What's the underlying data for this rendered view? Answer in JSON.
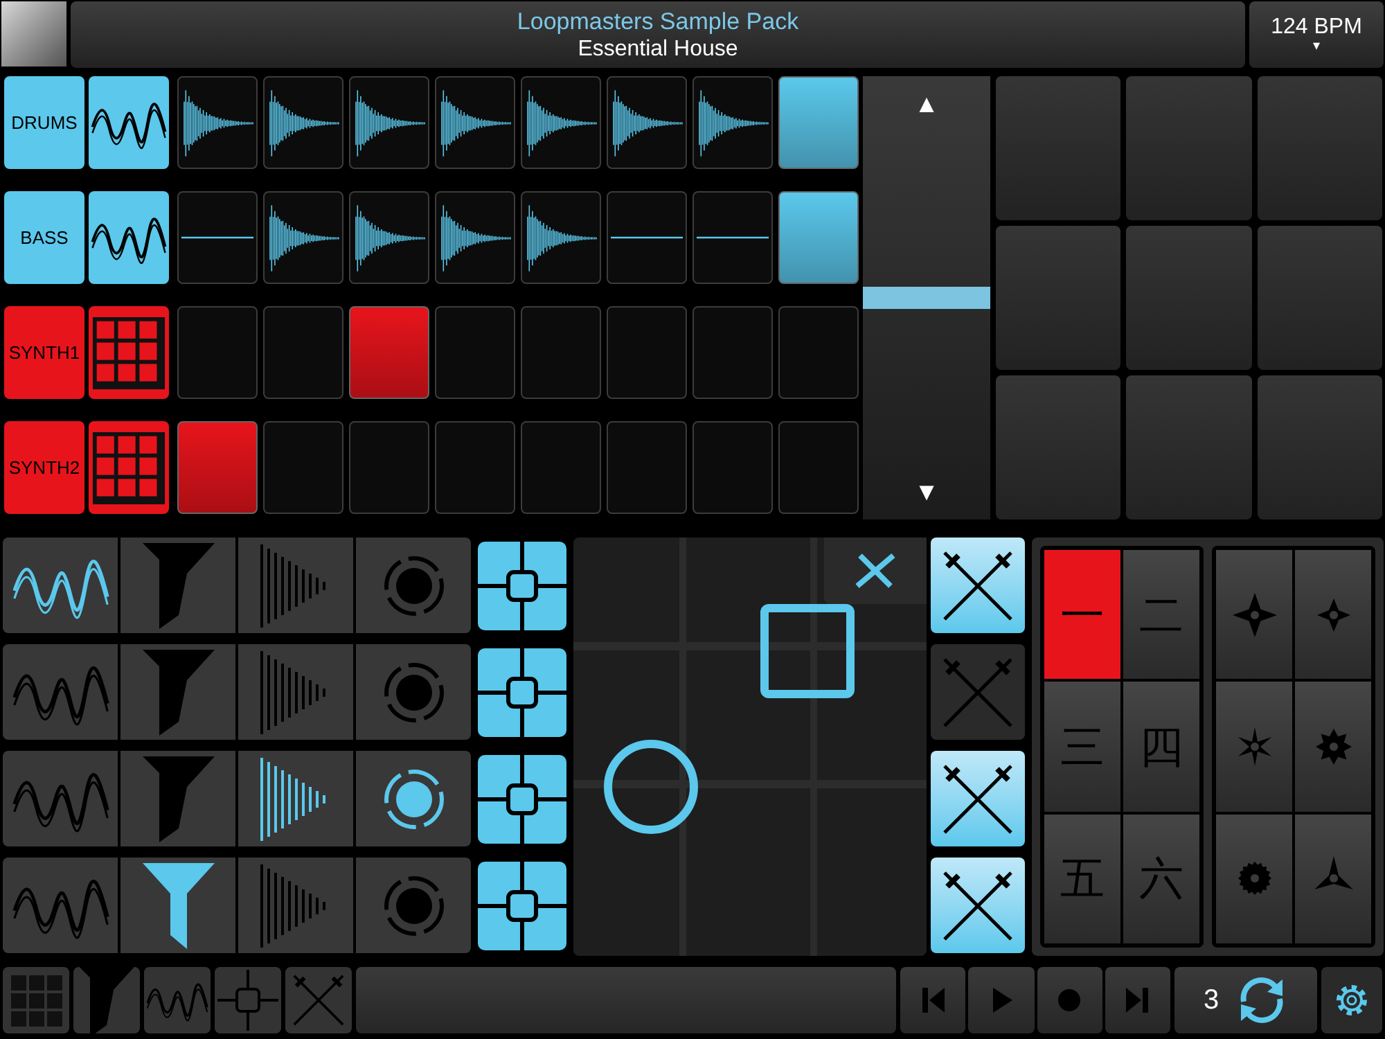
{
  "header": {
    "title": "Loopmasters Sample Pack",
    "subtitle": "Essential House",
    "tempo": "124 BPM",
    "tempo_caret": "▾"
  },
  "tracks": [
    {
      "name": "DRUMS",
      "kind": "audio",
      "color": "#5bc8ec",
      "clips": [
        {
          "kind": "hit",
          "lit": false
        },
        {
          "kind": "hit",
          "lit": false
        },
        {
          "kind": "hit",
          "lit": false
        },
        {
          "kind": "hit",
          "lit": false
        },
        {
          "kind": "hit",
          "lit": false
        },
        {
          "kind": "hit",
          "lit": false
        },
        {
          "kind": "hit",
          "lit": false
        },
        {
          "kind": "empty",
          "lit": true
        }
      ]
    },
    {
      "name": "BASS",
      "kind": "audio",
      "color": "#5bc8ec",
      "clips": [
        {
          "kind": "flat",
          "lit": false
        },
        {
          "kind": "hit",
          "lit": false
        },
        {
          "kind": "hit",
          "lit": false
        },
        {
          "kind": "hit",
          "lit": false
        },
        {
          "kind": "hit",
          "lit": false
        },
        {
          "kind": "flat",
          "lit": false
        },
        {
          "kind": "flat",
          "lit": false
        },
        {
          "kind": "empty",
          "lit": true
        }
      ]
    },
    {
      "name": "SYNTH1",
      "kind": "midi",
      "color": "#e8141c",
      "clips": [
        {
          "kind": "empty",
          "lit": false
        },
        {
          "kind": "empty",
          "lit": false
        },
        {
          "kind": "empty",
          "lit": true
        },
        {
          "kind": "empty",
          "lit": false
        },
        {
          "kind": "empty",
          "lit": false
        },
        {
          "kind": "empty",
          "lit": false
        },
        {
          "kind": "empty",
          "lit": false
        },
        {
          "kind": "empty",
          "lit": false
        }
      ]
    },
    {
      "name": "SYNTH2",
      "kind": "midi",
      "color": "#e8141c",
      "clips": [
        {
          "kind": "empty",
          "lit": true
        },
        {
          "kind": "empty",
          "lit": false
        },
        {
          "kind": "empty",
          "lit": false
        },
        {
          "kind": "empty",
          "lit": false
        },
        {
          "kind": "empty",
          "lit": false
        },
        {
          "kind": "empty",
          "lit": false
        },
        {
          "kind": "empty",
          "lit": false
        },
        {
          "kind": "empty",
          "lit": false
        }
      ]
    }
  ],
  "volume": {
    "up": "▲",
    "down": "▼",
    "level": 0.5
  },
  "effects": [
    {
      "chain": [
        {
          "kind": "oscillator",
          "on": true
        },
        {
          "kind": "filter",
          "on": false
        },
        {
          "kind": "delay",
          "on": false
        },
        {
          "kind": "reverb",
          "on": false
        }
      ]
    },
    {
      "chain": [
        {
          "kind": "oscillator",
          "on": false
        },
        {
          "kind": "filter",
          "on": false
        },
        {
          "kind": "delay",
          "on": false
        },
        {
          "kind": "reverb",
          "on": false
        }
      ]
    },
    {
      "chain": [
        {
          "kind": "oscillator",
          "on": false
        },
        {
          "kind": "filter",
          "on": false
        },
        {
          "kind": "delay",
          "on": true
        },
        {
          "kind": "reverb",
          "on": true
        }
      ]
    },
    {
      "chain": [
        {
          "kind": "oscillator",
          "on": false
        },
        {
          "kind": "filter",
          "on": true
        },
        {
          "kind": "delay",
          "on": false
        },
        {
          "kind": "reverb",
          "on": false
        }
      ]
    }
  ],
  "swords": [
    {
      "on": true
    },
    {
      "on": false
    },
    {
      "on": true
    },
    {
      "on": true
    }
  ],
  "kanji": [
    {
      "label": "一",
      "selected": true
    },
    {
      "label": "二",
      "selected": false
    },
    {
      "label": "三",
      "selected": false
    },
    {
      "label": "四",
      "selected": false
    },
    {
      "label": "五",
      "selected": false
    },
    {
      "label": "六",
      "selected": false
    }
  ],
  "transport": {
    "loop_count": "3"
  }
}
